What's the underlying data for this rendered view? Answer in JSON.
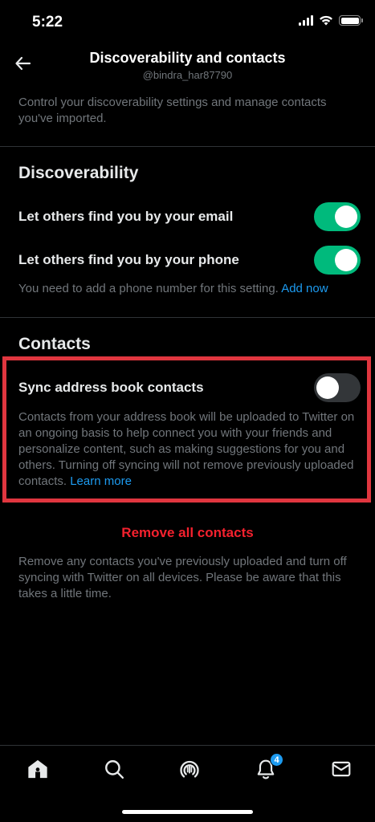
{
  "status_bar": {
    "time": "5:22"
  },
  "header": {
    "title": "Discoverability and contacts",
    "subtitle": "@bindra_har87790"
  },
  "intro": "Control your discoverability settings and manage contacts you've imported.",
  "discoverability": {
    "title": "Discoverability",
    "email_label": "Let others find you by your email",
    "email_enabled": true,
    "phone_label": "Let others find you by your phone",
    "phone_enabled": true,
    "phone_helper": "You need to add a phone number for this setting.",
    "add_now": "Add now"
  },
  "contacts": {
    "title": "Contacts",
    "sync_label": "Sync address book contacts",
    "sync_enabled": false,
    "sync_description": "Contacts from your address book will be uploaded to Twitter on an ongoing basis to help connect you with your friends and personalize content, such as making suggestions for you and others. Turning off syncing will not remove previously uploaded contacts.",
    "learn_more": "Learn more",
    "remove_all": "Remove all contacts",
    "remove_description": "Remove any contacts you've previously uploaded and turn off syncing with Twitter on all devices. Please be aware that this takes a little time."
  },
  "bottom_nav": {
    "items": [
      {
        "icon": "home-icon"
      },
      {
        "icon": "search-icon"
      },
      {
        "icon": "spaces-icon"
      },
      {
        "icon": "notifications-icon",
        "badge": "4"
      },
      {
        "icon": "messages-icon"
      }
    ]
  },
  "colors": {
    "accent": "#1d9bf0",
    "toggle_on": "#00ba7c",
    "danger": "#f4212e",
    "highlight": "#e0363f"
  }
}
